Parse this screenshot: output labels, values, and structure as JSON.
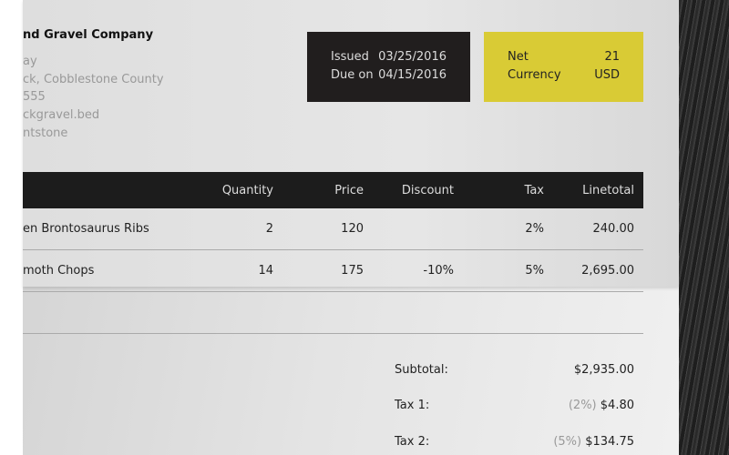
{
  "company": {
    "name": "nd Gravel Company",
    "address_lines": [
      "ay",
      "ck, Cobblestone County",
      "555",
      "ckgravel.bed",
      "ntstone"
    ]
  },
  "dates": {
    "issued_label": "Issued",
    "issued": "03/25/2016",
    "due_label": "Due on",
    "due": "04/15/2016"
  },
  "terms": {
    "net_label": "Net",
    "net": "21",
    "currency_label": "Currency",
    "currency": "USD"
  },
  "table": {
    "headers": [
      "Quantity",
      "Price",
      "Discount",
      "Tax",
      "Linetotal"
    ],
    "rows": [
      {
        "item": "en Brontosaurus Ribs",
        "quantity": "2",
        "price": "120",
        "discount": "",
        "tax": "2%",
        "linetotal": "240.00"
      },
      {
        "item": "moth Chops",
        "quantity": "14",
        "price": "175",
        "discount": "-10%",
        "tax": "5%",
        "linetotal": "2,695.00"
      }
    ]
  },
  "totals": {
    "subtotal_label": "Subtotal:",
    "subtotal": "$2,935.00",
    "tax1_label": "Tax 1:",
    "tax1_pct": "(2%)",
    "tax1": "$4.80",
    "tax2_label": "Tax 2:",
    "tax2_pct": "(5%)",
    "tax2": "$134.75"
  },
  "colors": {
    "dark_box": "#211e1e",
    "accent_yellow": "#d9cb35",
    "header_bg": "#1c1c1c"
  }
}
